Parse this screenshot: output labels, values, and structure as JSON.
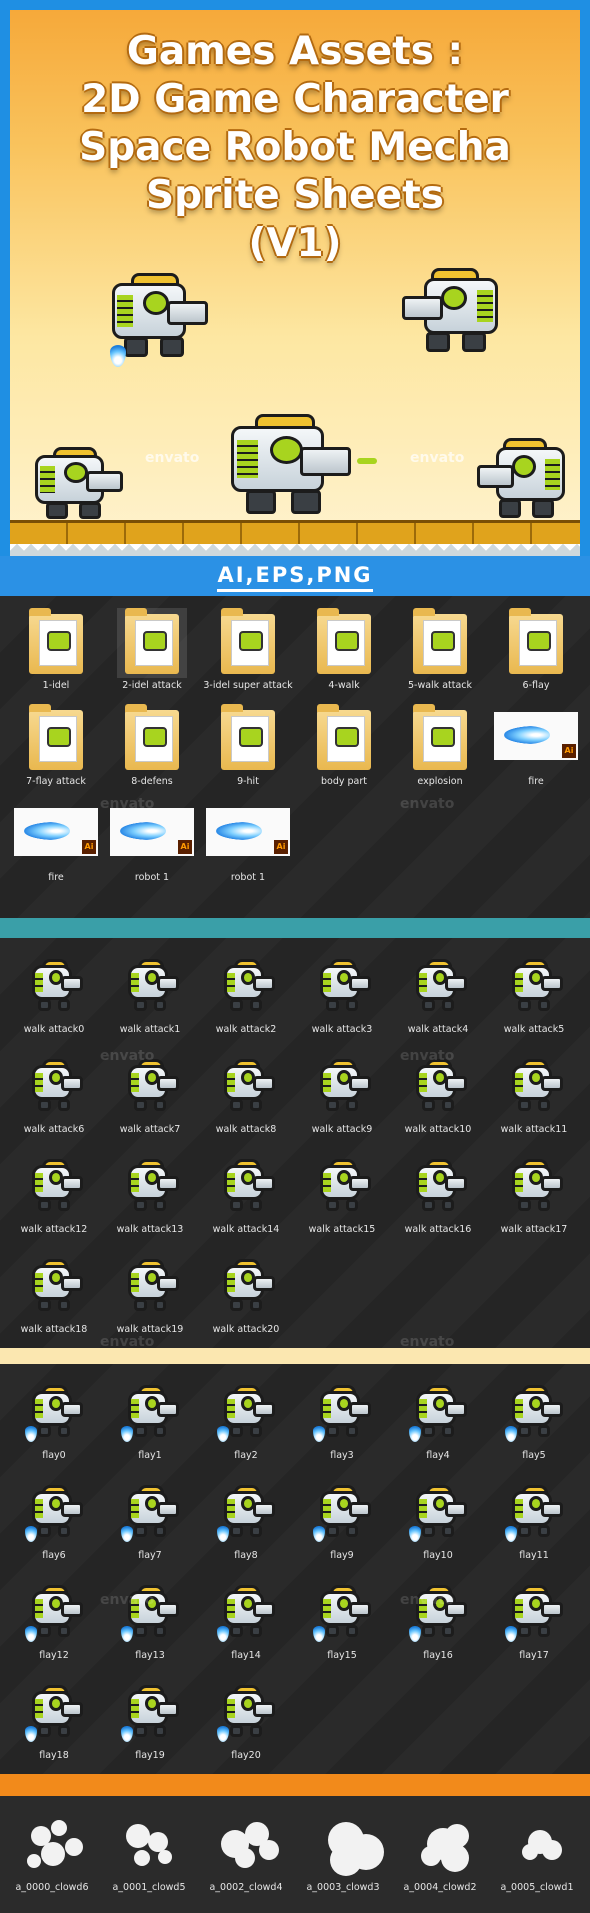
{
  "hero": {
    "title_lines": [
      "Games Assets :",
      "2D Game Character",
      "Space Robot Mecha",
      "Sprite Sheets",
      "(V1)"
    ],
    "formats": "AI,EPS,PNG",
    "colors": {
      "frame": "#1f8fe3",
      "sky_top": "#f6a93a",
      "sky_bottom": "#fff3d0"
    }
  },
  "watermarks": {
    "envato": "envato"
  },
  "folders": [
    {
      "label": "1-idel",
      "type": "folder"
    },
    {
      "label": "2-idel attack",
      "type": "folder",
      "selected": true
    },
    {
      "label": "3-idel super attack",
      "type": "folder"
    },
    {
      "label": "4-walk",
      "type": "folder"
    },
    {
      "label": "5-walk attack",
      "type": "folder"
    },
    {
      "label": "6-flay",
      "type": "folder"
    },
    {
      "label": "7-flay attack",
      "type": "folder"
    },
    {
      "label": "8-defens",
      "type": "folder"
    },
    {
      "label": "9-hit",
      "type": "folder"
    },
    {
      "label": "body part",
      "type": "folder"
    },
    {
      "label": "explosion",
      "type": "folder"
    },
    {
      "label": "fire",
      "type": "ai"
    },
    {
      "label": "fire",
      "type": "ai"
    },
    {
      "label": "robot 1",
      "type": "ai"
    },
    {
      "label": "robot 1",
      "type": "ai"
    }
  ],
  "walk_attack": [
    "walk attack0",
    "walk attack1",
    "walk attack2",
    "walk attack3",
    "walk attack4",
    "walk attack5",
    "walk attack6",
    "walk attack7",
    "walk attack8",
    "walk attack9",
    "walk attack10",
    "walk attack11",
    "walk attack12",
    "walk attack13",
    "walk attack14",
    "walk attack15",
    "walk attack16",
    "walk attack17",
    "walk attack18",
    "walk attack19",
    "walk attack20"
  ],
  "flay": [
    "flay0",
    "flay1",
    "flay2",
    "flay3",
    "flay4",
    "flay5",
    "flay6",
    "flay7",
    "flay8",
    "flay9",
    "flay10",
    "flay11",
    "flay12",
    "flay13",
    "flay14",
    "flay15",
    "flay16",
    "flay17",
    "flay18",
    "flay19",
    "flay20"
  ],
  "clouds": [
    "a_0000_clowd6",
    "a_0001_clowd5",
    "a_0002_clowd4",
    "a_0003_clowd3",
    "a_0004_clowd2",
    "a_0005_clowd1"
  ],
  "dividers": {
    "teal": "#3a9fa8",
    "cream": "#fbe7b0",
    "orange": "#f28a1b"
  }
}
